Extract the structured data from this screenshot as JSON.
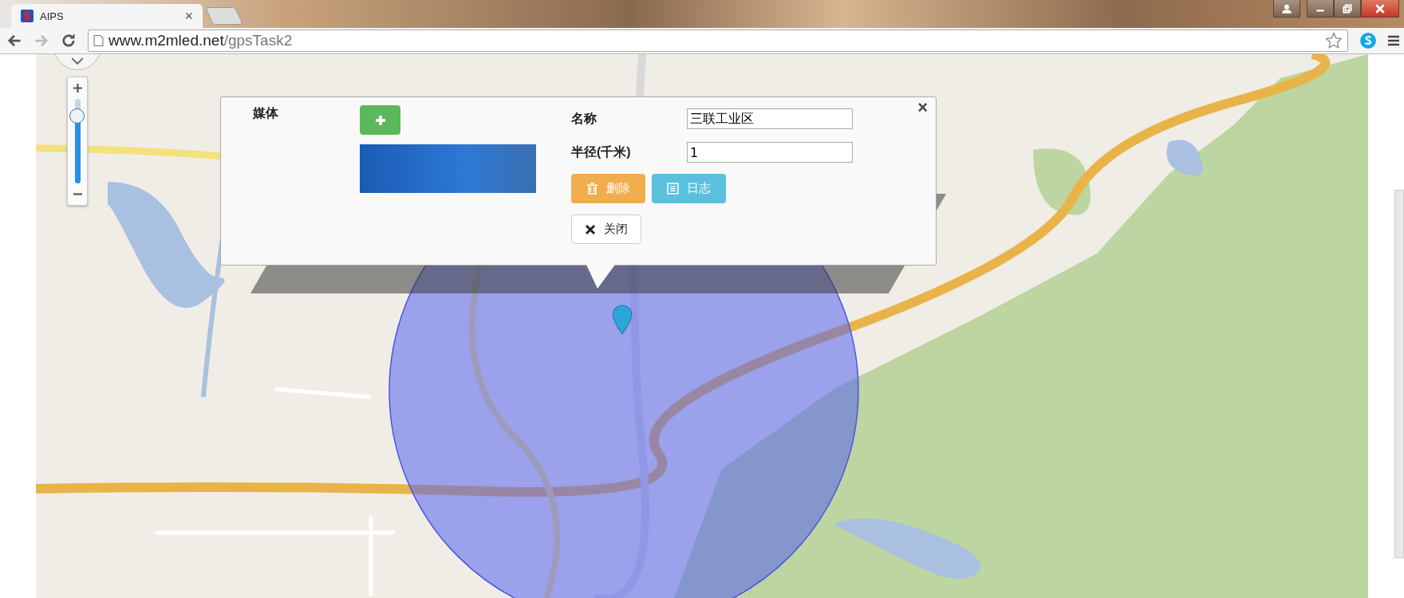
{
  "browser": {
    "tabs": [
      {
        "title": "AIPS",
        "close": "×",
        "selected": true
      }
    ],
    "url": "**www.m2mled.net**/gpsTask2"
  },
  "map": {
    "zoom": {
      "level": 0.8
    }
  },
  "popup": {
    "close": "×",
    "media_label": "媒体",
    "fields": [
      {
        "label": "名称",
        "value": "三联工业区"
      },
      {
        "label": "半径(千米)",
        "value": "1"
      }
    ],
    "buttons": [
      {
        "kind": "delete",
        "label": "删除"
      },
      {
        "kind": "log",
        "label": "日志"
      },
      {
        "kind": "close",
        "label": "关闭"
      }
    ]
  }
}
